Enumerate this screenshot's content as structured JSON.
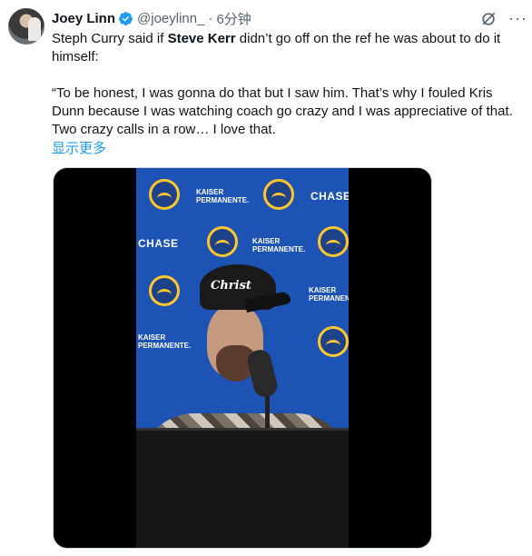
{
  "author": {
    "name": "Joey Linn",
    "handle": "@joeylinn_",
    "separator": "·",
    "time": "6分钟"
  },
  "tweet": {
    "line1_pre": "Steph Curry said if ",
    "line1_bold": "Steve Kerr",
    "line1_post": " didn’t go off on the ref he was about to do it himself:",
    "quote": "“To be honest, I was gonna do that but I saw him. That’s why I fouled Kris Dunn because I was watching coach go crazy and I was appreciative of that. Two crazy calls in a row… I love that.",
    "show_more": "显示更多"
  },
  "media": {
    "backdrop_sponsor_chase": "CHASE",
    "backdrop_sponsor_kaiser_1": "KAISER",
    "backdrop_sponsor_kaiser_2": "PERMANENTE.",
    "cap_text": "Christ"
  },
  "icons": {
    "verified": "verified-badge-icon",
    "grok": "grok-icon",
    "more": "more-options-icon"
  },
  "colors": {
    "link": "#1d9bf0",
    "text": "#0f1419",
    "secondary": "#536471",
    "backdrop": "#1d53b5"
  }
}
